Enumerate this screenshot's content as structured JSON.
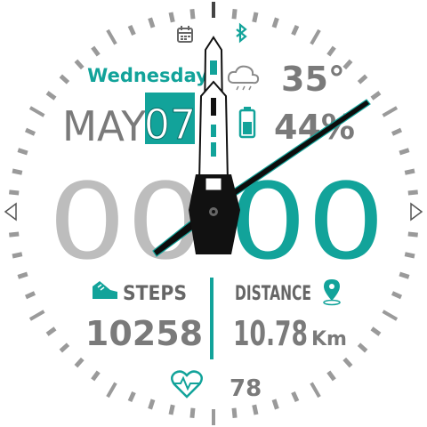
{
  "date": {
    "weekday": "Wednesday",
    "month": "MAY",
    "day": "07"
  },
  "weather": {
    "temperature": "35°",
    "condition_icon": "cloud-rain-icon"
  },
  "battery": {
    "level": "44%",
    "icon": "battery-icon"
  },
  "time": {
    "hours": "00",
    "minutes": "00"
  },
  "steps": {
    "label": "STEPS",
    "value": "10258",
    "icon": "shoe-icon"
  },
  "distance": {
    "label": "DISTANCE",
    "value": "10.78",
    "unit": "Km",
    "icon": "location-pin-icon"
  },
  "heart_rate": {
    "value": "78",
    "icon": "heart-rate-icon"
  },
  "status_icons": [
    "calendar-icon",
    "bluetooth-icon"
  ],
  "colors": {
    "accent": "#12a39a",
    "gray": "#7a7a7a",
    "light_gray": "#bdbdbd",
    "dark": "#111111"
  }
}
